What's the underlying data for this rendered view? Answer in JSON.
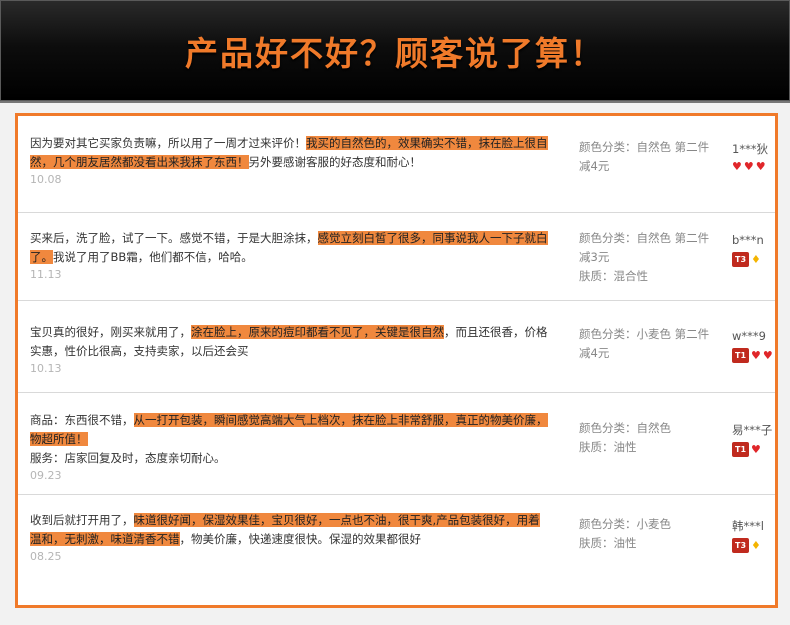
{
  "banner": {
    "title": "产品好不好？顾客说了算！"
  },
  "reviews": [
    {
      "parts": [
        {
          "text": "因为要对其它买家负责嘛，所以用了一周才过来评价！",
          "hl": false
        },
        {
          "text": "我买的自然色的，效果确实不错，抹在脸上很自然，几个朋友居然都没看出来我抹了东西！",
          "hl": true
        },
        {
          "text": "另外要感谢客服的好态度和耐心！",
          "hl": false
        }
      ],
      "date": "10.08",
      "sku": [
        "颜色分类：自然色 第二件减4元"
      ],
      "user": "1***狄",
      "level": "",
      "hearts": 3,
      "crown": false
    },
    {
      "parts": [
        {
          "text": "买来后，洗了脸，试了一下。感觉不错，于是大胆涂抹，",
          "hl": false
        },
        {
          "text": "感觉立刻白皙了很多，同事说我人一下子就白了。",
          "hl": true
        },
        {
          "text": "我说了用了BB霜，他们都不信，哈哈。",
          "hl": false
        }
      ],
      "date": "11.13",
      "sku": [
        "颜色分类：自然色 第二件减3元",
        "肤质：混合性"
      ],
      "user": "b***n",
      "level": "T3",
      "hearts": 0,
      "crown": true
    },
    {
      "parts": [
        {
          "text": "宝贝真的很好，刚买来就用了，",
          "hl": false
        },
        {
          "text": "涂在脸上，原来的痘印都看不见了，关键是很自然",
          "hl": true
        },
        {
          "text": "，而且还很香，价格实惠，性价比很高，支持卖家，以后还会买",
          "hl": false
        }
      ],
      "date": "10.13",
      "sku": [
        "颜色分类：小麦色 第二件减4元"
      ],
      "user": "w***9",
      "level": "T1",
      "hearts": 2,
      "crown": false
    },
    {
      "parts": [
        {
          "text": "商品：东西很不错，",
          "hl": false
        },
        {
          "text": "从一打开包装，瞬间感觉高端大气上档次，抹在脸上非常舒服，真正的物美价廉，物超所值！",
          "hl": true
        },
        {
          "text": "服务：店家回复及时，态度亲切耐心。",
          "hl": false,
          "br": true
        }
      ],
      "date": "09.23",
      "sku": [
        "颜色分类：自然色",
        "肤质：油性"
      ],
      "user": "易***子",
      "level": "T1",
      "hearts": 1,
      "crown": false
    },
    {
      "parts": [
        {
          "text": "收到后就打开用了，",
          "hl": false
        },
        {
          "text": "味道很好闻，保湿效果佳，宝贝很好，一点也不油，很干爽,产品包装很好，用着温和，无刺激，味道清香不错",
          "hl": true
        },
        {
          "text": "，物美价廉，快递速度很快。保湿的效果都很好",
          "hl": false
        }
      ],
      "date": "08.25",
      "sku": [
        "颜色分类：小麦色",
        "肤质：油性"
      ],
      "user": "韩***l",
      "level": "T3",
      "hearts": 0,
      "crown": true
    }
  ]
}
